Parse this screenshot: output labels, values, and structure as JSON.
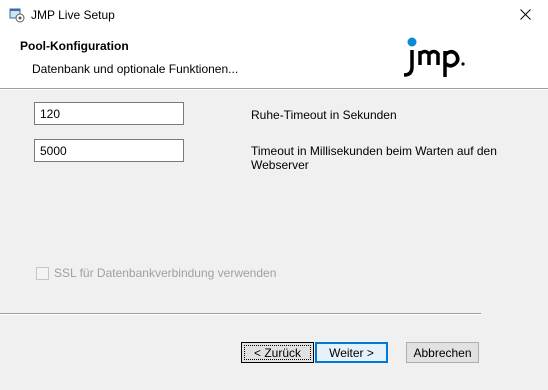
{
  "window": {
    "title": "JMP Live Setup",
    "close_glyph": "✕"
  },
  "header": {
    "title": "Pool-Konfiguration",
    "subtitle": "Datenbank und optionale Funktionen...",
    "logo_text": "jmp",
    "accent": "#0a8bd1"
  },
  "fields": [
    {
      "value": "120",
      "label": "Ruhe-Timeout in Sekunden"
    },
    {
      "value": "5000",
      "label_line1": "Timeout in Millisekunden beim Warten auf den",
      "label_line2": "Webserver"
    }
  ],
  "ssl_checkbox": {
    "label": "SSL für Datenbankverbindung verwenden",
    "checked": false,
    "disabled": true
  },
  "buttons": {
    "back": "< Zurück",
    "next": "Weiter >",
    "cancel": "Abbrechen"
  }
}
